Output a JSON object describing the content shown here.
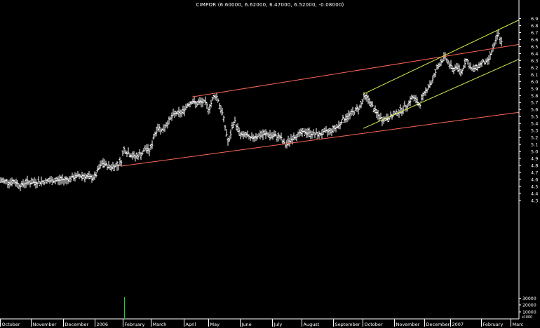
{
  "chart_data": {
    "type": "ohlc",
    "title": "CIMPOR (6.60000, 6.62000, 6.47000, 6.52000, -0.08000)",
    "x_labels": [
      "October",
      "November",
      "December",
      "2006",
      "February",
      "March",
      "April",
      "May",
      "June",
      "July",
      "August",
      "September",
      "October",
      "November",
      "December",
      "2007",
      "February",
      "Marc"
    ],
    "y_ticks": [
      6.9,
      6.8,
      6.7,
      6.6,
      6.5,
      6.4,
      6.3,
      6.2,
      6.1,
      6.0,
      5.9,
      5.8,
      5.7,
      5.6,
      5.5,
      5.4,
      5.3,
      5.2,
      5.1,
      5.0,
      4.9,
      4.8,
      4.7,
      4.6,
      4.5,
      4.4,
      4.3
    ],
    "ylim": [
      4.2,
      6.98
    ],
    "volume_ticks": [
      "30000",
      "20000",
      "10000"
    ],
    "volume_unit": "x1000",
    "price_path": [
      [
        0,
        4.58
      ],
      [
        12,
        4.57
      ],
      [
        22,
        4.56
      ],
      [
        30,
        4.51
      ],
      [
        36,
        4.56
      ],
      [
        48,
        4.56
      ],
      [
        60,
        4.57
      ],
      [
        72,
        4.58
      ],
      [
        84,
        4.59
      ],
      [
        96,
        4.6
      ],
      [
        108,
        4.64
      ],
      [
        118,
        4.66
      ],
      [
        128,
        4.62
      ],
      [
        136,
        4.64
      ],
      [
        140,
        4.74
      ],
      [
        146,
        4.84
      ],
      [
        152,
        4.8
      ],
      [
        158,
        4.78
      ],
      [
        166,
        4.8
      ],
      [
        170,
        4.82
      ],
      [
        174,
        4.88
      ],
      [
        176,
        5.05
      ],
      [
        180,
        5.0
      ],
      [
        186,
        4.96
      ],
      [
        192,
        4.92
      ],
      [
        198,
        4.95
      ],
      [
        204,
        4.98
      ],
      [
        208,
        5.06
      ],
      [
        212,
        5.0
      ],
      [
        216,
        5.06
      ],
      [
        220,
        5.25
      ],
      [
        226,
        5.35
      ],
      [
        232,
        5.3
      ],
      [
        238,
        5.4
      ],
      [
        244,
        5.48
      ],
      [
        250,
        5.55
      ],
      [
        256,
        5.54
      ],
      [
        260,
        5.56
      ],
      [
        264,
        5.62
      ],
      [
        268,
        5.68
      ],
      [
        274,
        5.72
      ],
      [
        280,
        5.68
      ],
      [
        286,
        5.7
      ],
      [
        292,
        5.7
      ],
      [
        298,
        5.6
      ],
      [
        302,
        5.72
      ],
      [
        306,
        5.8
      ],
      [
        310,
        5.78
      ],
      [
        314,
        5.62
      ],
      [
        318,
        5.52
      ],
      [
        322,
        5.3
      ],
      [
        326,
        5.1
      ],
      [
        330,
        5.3
      ],
      [
        334,
        5.45
      ],
      [
        338,
        5.35
      ],
      [
        342,
        5.25
      ],
      [
        346,
        5.22
      ],
      [
        350,
        5.25
      ],
      [
        354,
        5.2
      ],
      [
        358,
        5.18
      ],
      [
        364,
        5.22
      ],
      [
        370,
        5.23
      ],
      [
        376,
        5.24
      ],
      [
        382,
        5.25
      ],
      [
        388,
        5.22
      ],
      [
        394,
        5.22
      ],
      [
        400,
        5.2
      ],
      [
        404,
        5.12
      ],
      [
        408,
        5.08
      ],
      [
        412,
        5.15
      ],
      [
        418,
        5.2
      ],
      [
        424,
        5.24
      ],
      [
        430,
        5.26
      ],
      [
        436,
        5.28
      ],
      [
        442,
        5.26
      ],
      [
        448,
        5.25
      ],
      [
        454,
        5.24
      ],
      [
        460,
        5.26
      ],
      [
        466,
        5.28
      ],
      [
        472,
        5.3
      ],
      [
        478,
        5.34
      ],
      [
        484,
        5.38
      ],
      [
        488,
        5.46
      ],
      [
        494,
        5.48
      ],
      [
        500,
        5.54
      ],
      [
        506,
        5.58
      ],
      [
        512,
        5.62
      ],
      [
        516,
        5.7
      ],
      [
        520,
        5.79
      ],
      [
        524,
        5.76
      ],
      [
        528,
        5.7
      ],
      [
        532,
        5.62
      ],
      [
        536,
        5.56
      ],
      [
        540,
        5.5
      ],
      [
        546,
        5.45
      ],
      [
        552,
        5.48
      ],
      [
        558,
        5.5
      ],
      [
        564,
        5.54
      ],
      [
        570,
        5.58
      ],
      [
        576,
        5.62
      ],
      [
        582,
        5.68
      ],
      [
        588,
        5.78
      ],
      [
        594,
        5.72
      ],
      [
        598,
        5.66
      ],
      [
        602,
        5.76
      ],
      [
        606,
        5.84
      ],
      [
        610,
        5.92
      ],
      [
        616,
        6.0
      ],
      [
        622,
        6.16
      ],
      [
        626,
        6.24
      ],
      [
        630,
        6.3
      ],
      [
        634,
        6.35
      ],
      [
        638,
        6.3
      ],
      [
        642,
        6.22
      ],
      [
        646,
        6.16
      ],
      [
        650,
        6.22
      ],
      [
        654,
        6.18
      ],
      [
        658,
        6.12
      ],
      [
        662,
        6.26
      ],
      [
        666,
        6.32
      ],
      [
        670,
        6.2
      ],
      [
        674,
        6.16
      ],
      [
        678,
        6.2
      ],
      [
        682,
        6.22
      ],
      [
        686,
        6.26
      ],
      [
        690,
        6.28
      ],
      [
        694,
        6.26
      ],
      [
        698,
        6.34
      ],
      [
        702,
        6.46
      ],
      [
        706,
        6.52
      ],
      [
        710,
        6.7
      ],
      [
        714,
        6.6
      ],
      [
        716,
        6.52
      ]
    ],
    "trend_lines": [
      {
        "color": "#ff6655",
        "x0": 274,
        "y0": 5.78,
        "x1": 740,
        "y1": 6.53
      },
      {
        "color": "#ff6655",
        "x0": 172,
        "y0": 4.79,
        "x1": 740,
        "y1": 5.56
      },
      {
        "color": "#d8e84a",
        "x0": 518,
        "y0": 5.82,
        "x1": 740,
        "y1": 6.88
      },
      {
        "color": "#d8e84a",
        "x0": 518,
        "y0": 5.33,
        "x1": 740,
        "y1": 6.32
      }
    ],
    "volume_spike": {
      "x": 177,
      "value": 30000
    }
  }
}
